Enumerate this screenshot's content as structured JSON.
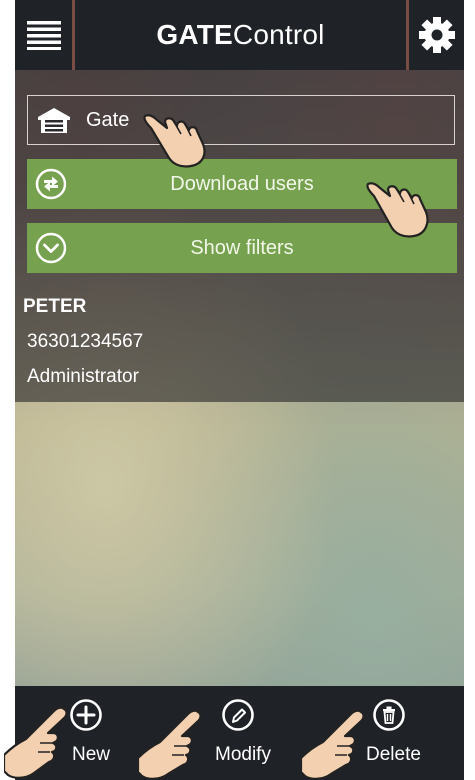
{
  "header": {
    "title_bold": "GATE",
    "title_regular": "Control",
    "menu_icon": "hamburger-menu-icon",
    "settings_icon": "gear-icon"
  },
  "gate_selector": {
    "label": "Gate",
    "icon": "garage-icon"
  },
  "actions": {
    "download_users": "Download users",
    "show_filters": "Show filters"
  },
  "user": {
    "name": "PETER",
    "phone": "36301234567",
    "role": "Administrator"
  },
  "bottom_bar": {
    "new_label": "New",
    "modify_label": "Modify",
    "delete_label": "Delete"
  },
  "colors": {
    "accent_green": "#76a14e",
    "bar_dark": "#1f2328",
    "separator": "#7a4d44"
  }
}
